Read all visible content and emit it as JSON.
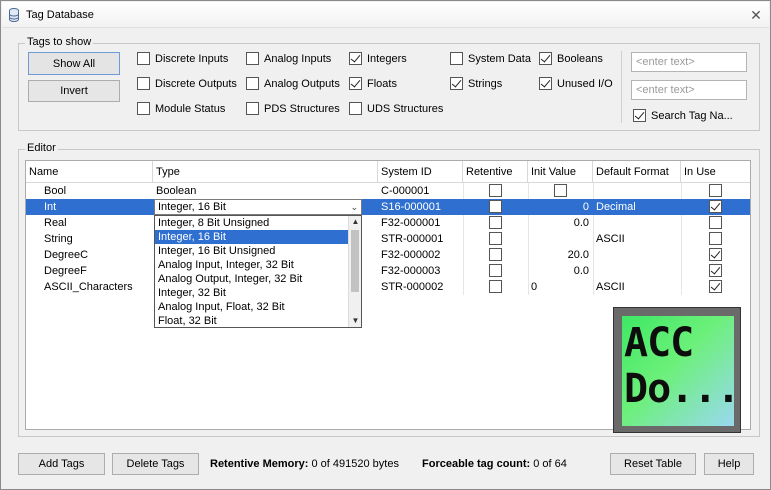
{
  "window": {
    "title": "Tag Database",
    "close_label": "✕"
  },
  "tags_to_show": {
    "legend": "Tags to show",
    "show_all": "Show All",
    "invert": "Invert",
    "checkboxes": [
      {
        "label": "Discrete Inputs",
        "checked": false
      },
      {
        "label": "Analog Inputs",
        "checked": false
      },
      {
        "label": "Integers",
        "checked": true
      },
      {
        "label": "System Data",
        "checked": false
      },
      {
        "label": "Booleans",
        "checked": true
      },
      {
        "label": "Discrete Outputs",
        "checked": false
      },
      {
        "label": "Analog Outputs",
        "checked": false
      },
      {
        "label": "Floats",
        "checked": true
      },
      {
        "label": "Strings",
        "checked": true
      },
      {
        "label": "Unused I/O",
        "checked": true
      },
      {
        "label": "Module Status",
        "checked": false
      },
      {
        "label": "PDS Structures",
        "checked": false
      },
      {
        "label": "UDS Structures",
        "checked": false
      }
    ],
    "filter1_placeholder": "<enter text>",
    "filter2_placeholder": "<enter text>",
    "search_tag_name": {
      "label": "Search Tag Na...",
      "checked": true
    }
  },
  "editor": {
    "legend": "Editor",
    "columns": [
      "Name",
      "Type",
      "System ID",
      "Retentive",
      "Init Value",
      "Default Format",
      "In Use"
    ],
    "rows": [
      {
        "name": "Bool",
        "type": "Boolean",
        "system_id": "C-000001",
        "retentive": false,
        "init_value": "",
        "init_checkbox": true,
        "default_format": "",
        "in_use": false
      },
      {
        "name": "Int",
        "type": "Integer, 16 Bit",
        "system_id": "S16-000001",
        "retentive": false,
        "init_value": "0",
        "default_format": "Decimal",
        "in_use": true
      },
      {
        "name": "Real",
        "type": "",
        "system_id": "F32-000001",
        "retentive": false,
        "init_value": "0.0",
        "default_format": "",
        "in_use": false
      },
      {
        "name": "String",
        "type": "",
        "system_id": "STR-000001",
        "retentive": false,
        "init_value": "",
        "default_format": "ASCII",
        "in_use": false
      },
      {
        "name": "DegreeC",
        "type": "",
        "system_id": "F32-000002",
        "retentive": false,
        "init_value": "20.0",
        "default_format": "",
        "in_use": true
      },
      {
        "name": "DegreeF",
        "type": "",
        "system_id": "F32-000003",
        "retentive": false,
        "init_value": "0.0",
        "default_format": "",
        "in_use": true
      },
      {
        "name": "ASCII_Characters",
        "type": "",
        "system_id": "STR-000002",
        "retentive": false,
        "init_value": "0",
        "init_left": true,
        "default_format": "ASCII",
        "in_use": true
      }
    ],
    "type_combo": {
      "value": "Integer, 16 Bit",
      "options": [
        "Integer, 8 Bit Unsigned",
        "Integer, 16 Bit",
        "Integer, 16 Bit Unsigned",
        "Analog Input, Integer, 32 Bit",
        "Analog Output, Integer, 32 Bit",
        "Integer, 32 Bit",
        "Analog Input, Float, 32 Bit",
        "Float, 32 Bit"
      ],
      "selected_index": 1
    },
    "logo_text": [
      "ACC",
      "Do..."
    ]
  },
  "footer": {
    "add_tags": "Add Tags",
    "delete_tags": "Delete Tags",
    "retentive_label": "Retentive Memory:",
    "retentive_value": "0 of 491520 bytes",
    "forceable_label": "Forceable tag count:",
    "forceable_value": "0 of 64",
    "reset_table": "Reset Table",
    "help": "Help"
  }
}
